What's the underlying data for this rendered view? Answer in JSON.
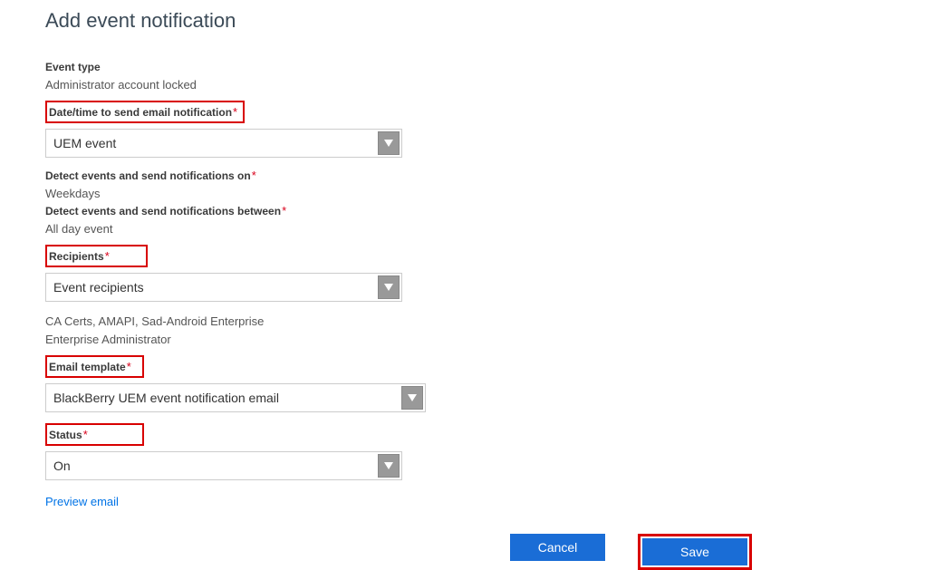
{
  "page": {
    "title": "Add event notification"
  },
  "labels": {
    "eventType": "Event type",
    "dateTime": "Date/time to send email notification",
    "detectOn": "Detect events and send notifications on",
    "detectBetween": "Detect events and send notifications between",
    "recipients": "Recipients",
    "emailTemplate": "Email template",
    "status": "Status"
  },
  "values": {
    "eventType": "Administrator account locked",
    "dateTimeSelect": "UEM event",
    "detectOn": "Weekdays",
    "detectBetween": "All day event",
    "recipientsSelect": "Event recipients",
    "recipientsList1": "CA Certs, AMAPI, Sad-Android Enterprise",
    "recipientsList2": "Enterprise Administrator",
    "emailTemplateSelect": "BlackBerry UEM event notification email",
    "statusSelect": "On"
  },
  "links": {
    "previewEmail": "Preview email"
  },
  "buttons": {
    "cancel": "Cancel",
    "save": "Save"
  },
  "required": "*"
}
